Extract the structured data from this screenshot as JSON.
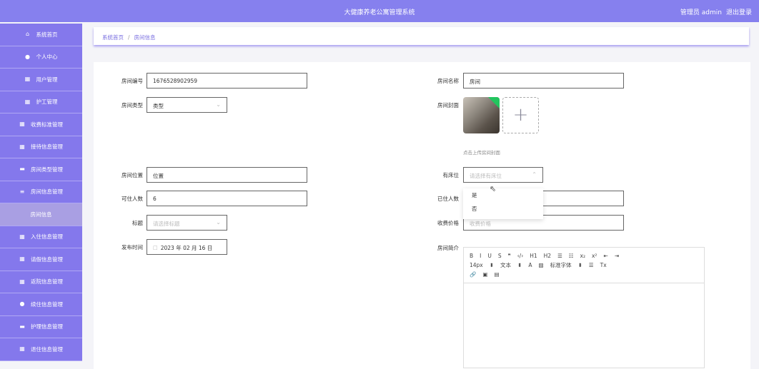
{
  "header": {
    "title": "大健康养老公寓管理系统",
    "user": "管理员 admin",
    "logout": "退出登录"
  },
  "sidebar": {
    "items": [
      {
        "label": "系统首页",
        "icon": "home-icon"
      },
      {
        "label": "个人中心",
        "icon": "user-icon"
      },
      {
        "label": "用户管理",
        "icon": "grid-icon"
      },
      {
        "label": "护工管理",
        "icon": "grid-icon"
      },
      {
        "label": "收费标准管理",
        "icon": "grid-icon"
      },
      {
        "label": "接待信息管理",
        "icon": "grid-icon"
      },
      {
        "label": "房间类型管理",
        "icon": "briefcase-icon"
      },
      {
        "label": "房间信息管理",
        "icon": "list-icon"
      },
      {
        "label": "房间信息",
        "icon": ""
      },
      {
        "label": "入住信息管理",
        "icon": "grid-icon"
      },
      {
        "label": "请假信息管理",
        "icon": "table-icon"
      },
      {
        "label": "返院信息管理",
        "icon": "grid-icon"
      },
      {
        "label": "续住信息管理",
        "icon": "user-icon"
      },
      {
        "label": "护理信息管理",
        "icon": "card-icon"
      },
      {
        "label": "退住信息管理",
        "icon": "grid-icon"
      }
    ]
  },
  "breadcrumb": {
    "home": "系统首页",
    "sep": "/",
    "current": "房间信息"
  },
  "form": {
    "room_no": {
      "label": "房间编号",
      "value": "1676528902959"
    },
    "room_name": {
      "label": "房间名称",
      "value": "房间"
    },
    "room_type": {
      "label": "房间类型",
      "value": "类型"
    },
    "cover": {
      "label": "房间封面",
      "hint": "点击上传房间封面",
      "add": "+"
    },
    "location": {
      "label": "房间位置",
      "value": "位置"
    },
    "has_bed": {
      "label": "有床位",
      "placeholder": "请选择有床位",
      "options": [
        "是",
        "否"
      ]
    },
    "capacity": {
      "label": "可住人数",
      "value": "6"
    },
    "occupied": {
      "label": "已住人数",
      "value": ""
    },
    "tag": {
      "label": "标题",
      "placeholder": "请选择标题"
    },
    "price": {
      "label": "收费价格",
      "placeholder": "收费价格"
    },
    "publish": {
      "label": "发布时间",
      "value": "2023 年 02 月 16 日"
    },
    "intro": {
      "label": "房间简介",
      "toolbar1": [
        "B",
        "I",
        "U",
        "S",
        "❞",
        "‹/›",
        "H1",
        "H2",
        "☰",
        "☷",
        "x₂",
        "x²",
        "⇤",
        "⇥"
      ],
      "toolbar2": [
        "14px",
        "⬍",
        "文本",
        "⬍",
        "A",
        "▨",
        "标准字体",
        "⬍",
        "☰",
        "Tx"
      ],
      "toolbar3": [
        "🔗",
        "▣",
        "▤"
      ]
    }
  }
}
